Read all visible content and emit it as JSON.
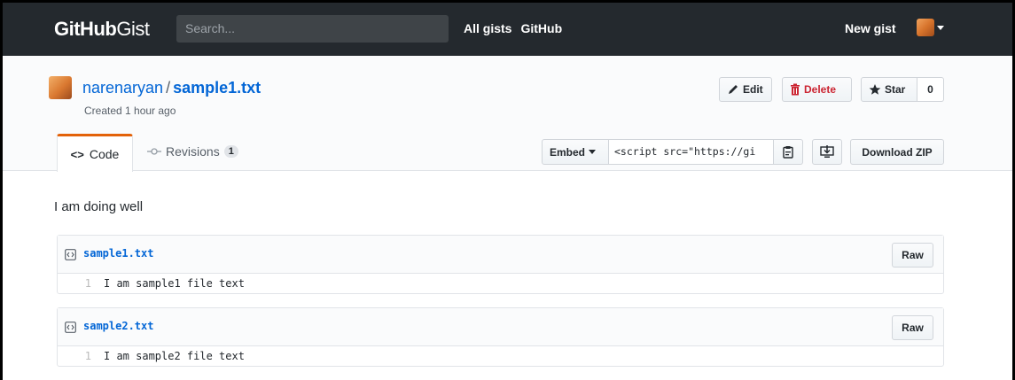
{
  "header": {
    "logo_bold": "GitHub",
    "logo_light": "Gist",
    "search_placeholder": "Search...",
    "nav": [
      "All gists",
      "GitHub"
    ],
    "new_gist": "New gist"
  },
  "gist": {
    "owner": "narenaryan",
    "separator": "/",
    "filename": "sample1.txt",
    "created": "Created 1 hour ago",
    "actions": {
      "edit": "Edit",
      "delete": "Delete",
      "star": "Star",
      "star_count": "0"
    },
    "tabs": {
      "code": "Code",
      "revisions": "Revisions",
      "revisions_count": "1"
    },
    "embed": {
      "label": "Embed",
      "value": "<script src=\"https://gi"
    },
    "download_zip": "Download ZIP"
  },
  "description": "I am doing well",
  "files": [
    {
      "name": "sample1.txt",
      "raw_label": "Raw",
      "lines": [
        {
          "no": "1",
          "text": "I am sample1 file text"
        }
      ]
    },
    {
      "name": "sample2.txt",
      "raw_label": "Raw",
      "lines": [
        {
          "no": "1",
          "text": "I am sample2 file text"
        }
      ]
    }
  ],
  "colors": {
    "header_bg": "#24292e",
    "link": "#0366d6",
    "tab_accent": "#e36209",
    "danger": "#cb2431"
  }
}
